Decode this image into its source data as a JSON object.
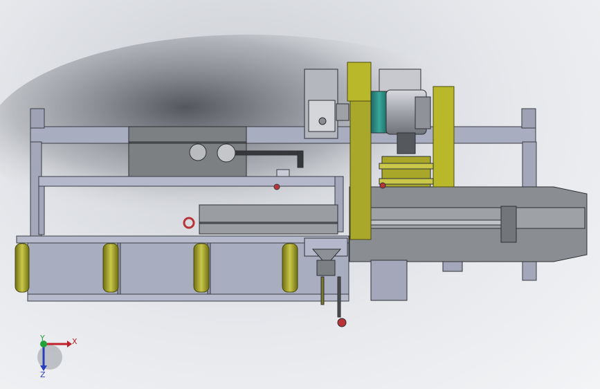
{
  "view": {
    "title": "",
    "background_colors": [
      "#4d5057",
      "#e6e8ec"
    ],
    "part_colors": {
      "frame": "#a9adc0",
      "roller_yellow": "#b8b82a",
      "motor_teal": "#2f8f86",
      "handle_red": "#b83238",
      "body_gray": "#7c7f82"
    }
  },
  "triad": {
    "x_label": "X",
    "y_label": "Y",
    "z_label": "Z",
    "x_color": "#c0202a",
    "y_color": "#23a23a",
    "z_color": "#2a3fbf"
  }
}
